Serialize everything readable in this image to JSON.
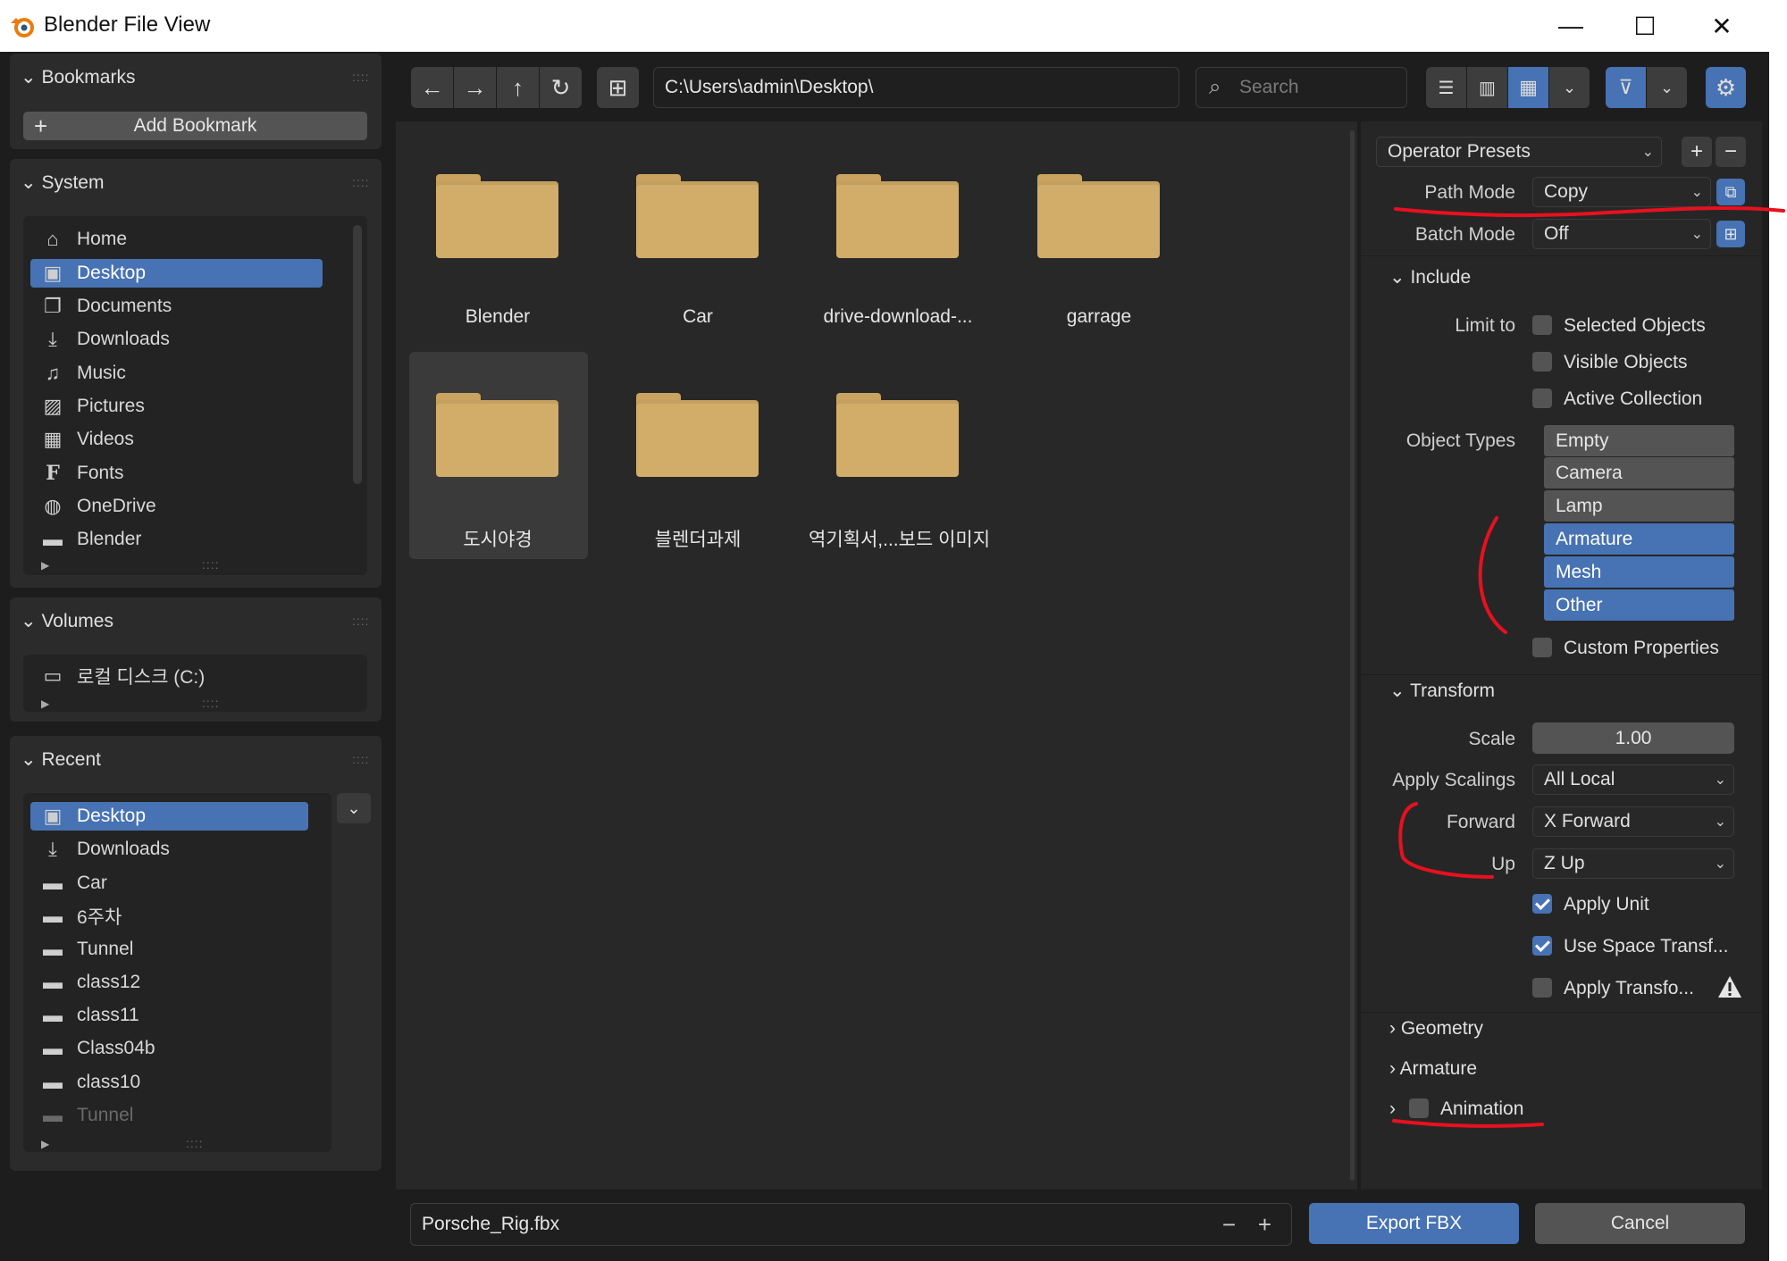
{
  "window": {
    "title": "Blender File View",
    "minimize": "—",
    "maximize": "☐",
    "close": "✕"
  },
  "sidebar": {
    "bookmarks": {
      "header": "Bookmarks",
      "add_label": "Add Bookmark",
      "add_icon": "+"
    },
    "system": {
      "header": "System",
      "items": [
        {
          "label": "Home",
          "icon": "home-icon"
        },
        {
          "label": "Desktop",
          "icon": "desktop-icon",
          "selected": true
        },
        {
          "label": "Documents",
          "icon": "documents-icon"
        },
        {
          "label": "Downloads",
          "icon": "download-icon"
        },
        {
          "label": "Music",
          "icon": "music-icon"
        },
        {
          "label": "Pictures",
          "icon": "image-icon"
        },
        {
          "label": "Videos",
          "icon": "video-icon"
        },
        {
          "label": "Fonts",
          "icon": "font-icon"
        },
        {
          "label": "OneDrive",
          "icon": "globe-icon"
        },
        {
          "label": "Blender",
          "icon": "folder-icon"
        }
      ]
    },
    "volumes": {
      "header": "Volumes",
      "items": [
        {
          "label": "로컬 디스크 (C:)",
          "icon": "disk-icon"
        }
      ]
    },
    "recent": {
      "header": "Recent",
      "items": [
        {
          "label": "Desktop",
          "icon": "desktop-icon",
          "selected": true
        },
        {
          "label": "Downloads",
          "icon": "download-icon"
        },
        {
          "label": "Car",
          "icon": "folder-icon"
        },
        {
          "label": "6주차",
          "icon": "folder-icon"
        },
        {
          "label": "Tunnel",
          "icon": "folder-icon"
        },
        {
          "label": "class12",
          "icon": "folder-icon"
        },
        {
          "label": "class11",
          "icon": "folder-icon"
        },
        {
          "label": "Class04b",
          "icon": "folder-icon"
        },
        {
          "label": "class10",
          "icon": "folder-icon"
        },
        {
          "label": "Tunnel",
          "icon": "folder-icon",
          "dim": true
        }
      ]
    }
  },
  "toolbar": {
    "path": "C:\\Users\\admin\\Desktop\\",
    "search_placeholder": "Search"
  },
  "files": [
    {
      "name": "Blender"
    },
    {
      "name": "Car"
    },
    {
      "name": "drive-download-..."
    },
    {
      "name": "garrage"
    },
    {
      "name": "도시야경",
      "highlighted": true
    },
    {
      "name": "블렌더과제"
    },
    {
      "name": "역기획서,...보드 이미지"
    }
  ],
  "settings": {
    "operator_presets": "Operator Presets",
    "path_mode": {
      "label": "Path Mode",
      "value": "Copy"
    },
    "batch_mode": {
      "label": "Batch Mode",
      "value": "Off"
    },
    "include": {
      "header": "Include",
      "limit_to_label": "Limit to",
      "limit_options": [
        {
          "label": "Selected Objects",
          "checked": false
        },
        {
          "label": "Visible Objects",
          "checked": false
        },
        {
          "label": "Active Collection",
          "checked": false
        }
      ],
      "object_types_label": "Object Types",
      "object_types": [
        {
          "label": "Empty",
          "on": false
        },
        {
          "label": "Camera",
          "on": false
        },
        {
          "label": "Lamp",
          "on": false
        },
        {
          "label": "Armature",
          "on": true
        },
        {
          "label": "Mesh",
          "on": true
        },
        {
          "label": "Other",
          "on": true
        }
      ],
      "custom_properties": {
        "label": "Custom Properties",
        "checked": false
      }
    },
    "transform": {
      "header": "Transform",
      "scale": {
        "label": "Scale",
        "value": "1.00"
      },
      "apply_scalings": {
        "label": "Apply Scalings",
        "value": "All Local"
      },
      "forward": {
        "label": "Forward",
        "value": "X Forward"
      },
      "up": {
        "label": "Up",
        "value": "Z Up"
      },
      "apply_unit": {
        "label": "Apply Unit",
        "checked": true
      },
      "use_space_transform": {
        "label": "Use Space Transf...",
        "checked": true
      },
      "apply_transform": {
        "label": "Apply Transfo...",
        "checked": false
      }
    },
    "geometry": {
      "header": "Geometry"
    },
    "armature": {
      "header": "Armature"
    },
    "animation": {
      "header": "Animation",
      "checked": false
    }
  },
  "footer": {
    "filename": "Porsche_Rig.fbx",
    "export_label": "Export FBX",
    "cancel_label": "Cancel"
  },
  "colors": {
    "accent": "#4772b3",
    "folder": "#d2ad6a",
    "annotation": "#e8101f",
    "background": "#1d1d1d"
  }
}
